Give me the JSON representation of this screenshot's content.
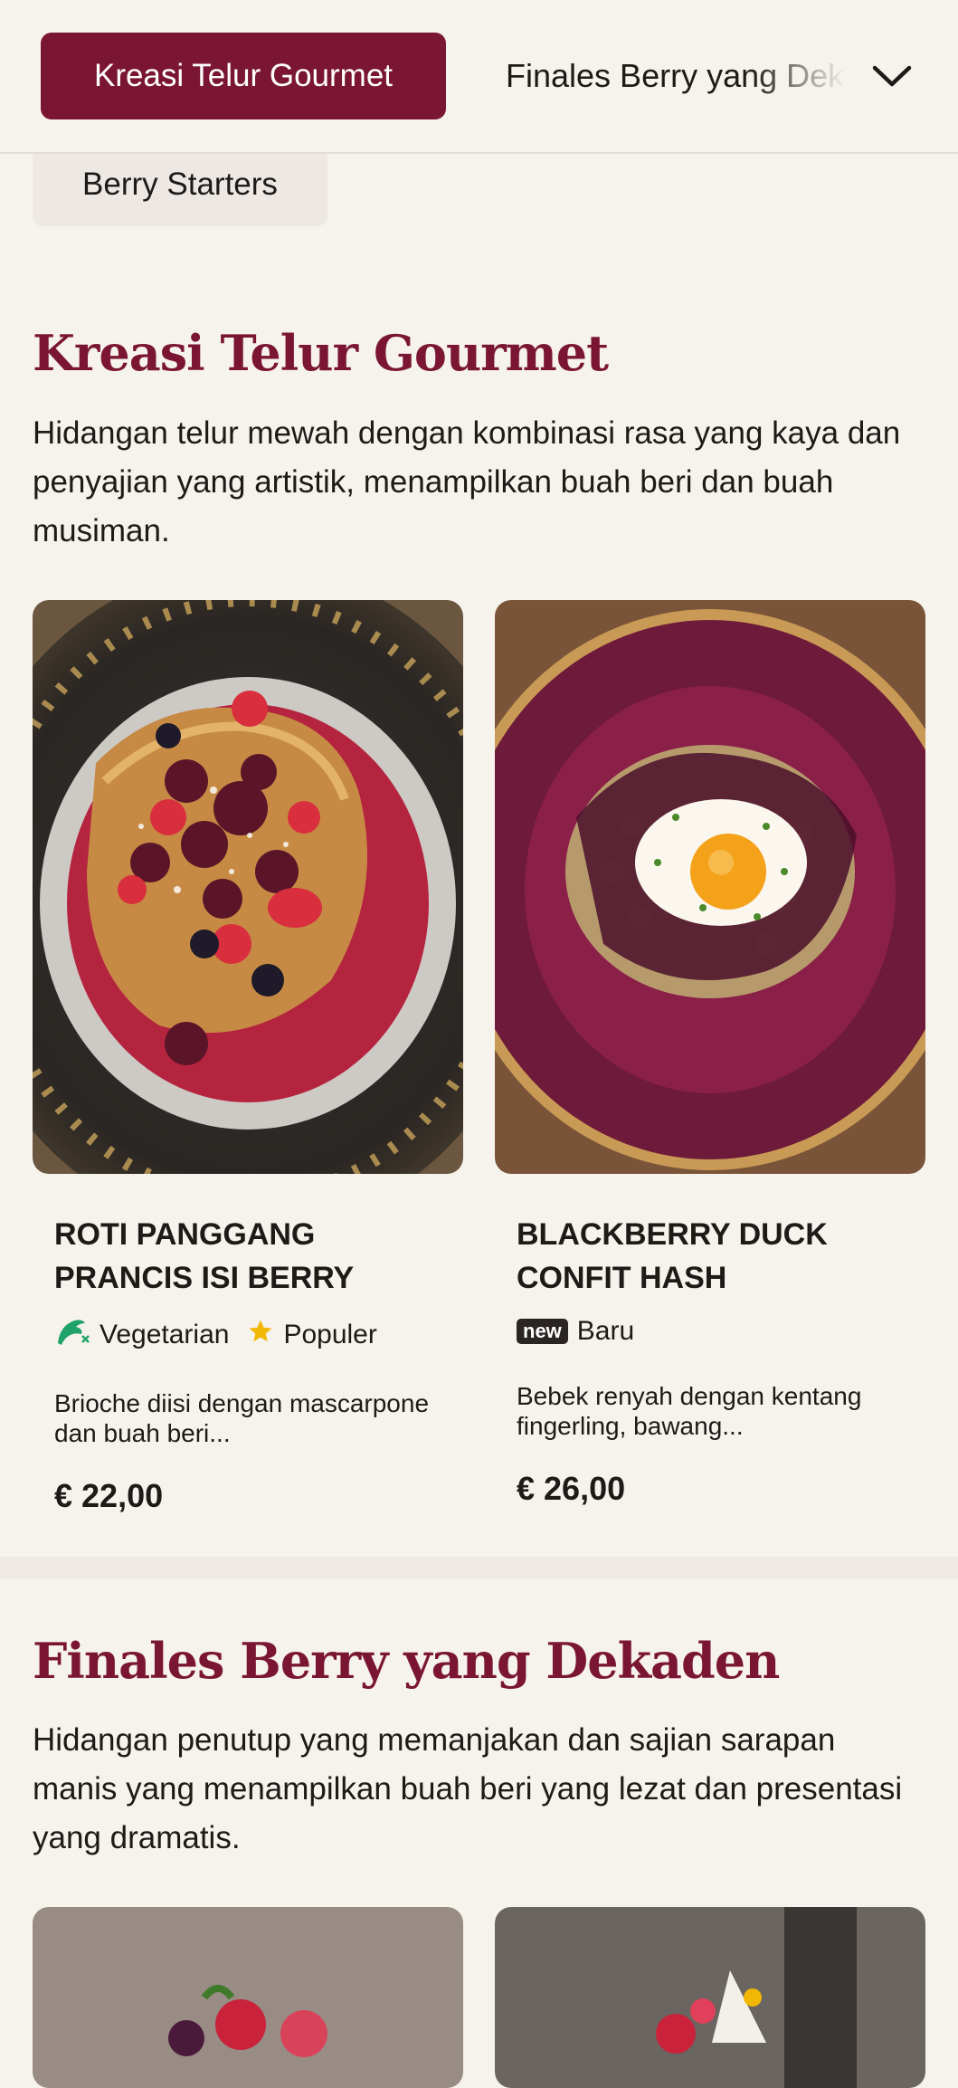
{
  "nav": {
    "active_label": "Kreasi Telur Gourmet",
    "next_label": "Finales Berry yang Dekaden",
    "prev_label": "Berry Starters",
    "expand_icon": "chevron-down-icon"
  },
  "sections": [
    {
      "title": "Kreasi Telur Gourmet",
      "description": "Hidangan telur mewah dengan kombinasi rasa yang kaya dan penyajian yang artistik, menampilkan buah beri dan buah musiman.",
      "items": [
        {
          "name": "ROTI PANGGANG PRANCIS ISI BERRY",
          "tags": [
            {
              "icon": "vegetarian-leaf-icon",
              "label": "Vegetarian"
            },
            {
              "icon": "star-icon",
              "label": "Populer"
            }
          ],
          "description": "Brioche diisi dengan mascarpone dan buah beri...",
          "price": "€ 22,00"
        },
        {
          "name": "BLACKBERRY DUCK CONFIT HASH",
          "tags": [
            {
              "icon": "new-badge",
              "badge": "new",
              "label": "Baru"
            }
          ],
          "description": "Bebek renyah dengan kentang fingerling, bawang...",
          "price": "€ 26,00"
        }
      ]
    },
    {
      "title": "Finales Berry yang Dekaden",
      "description": "Hidangan penutup yang memanjakan dan sajian sarapan manis yang menampilkan buah beri yang lezat dan presentasi yang dramatis."
    }
  ],
  "colors": {
    "accent": "#7a1634",
    "background": "#f6f2ec",
    "leaf": "#1fa36b",
    "star": "#f2b705"
  }
}
